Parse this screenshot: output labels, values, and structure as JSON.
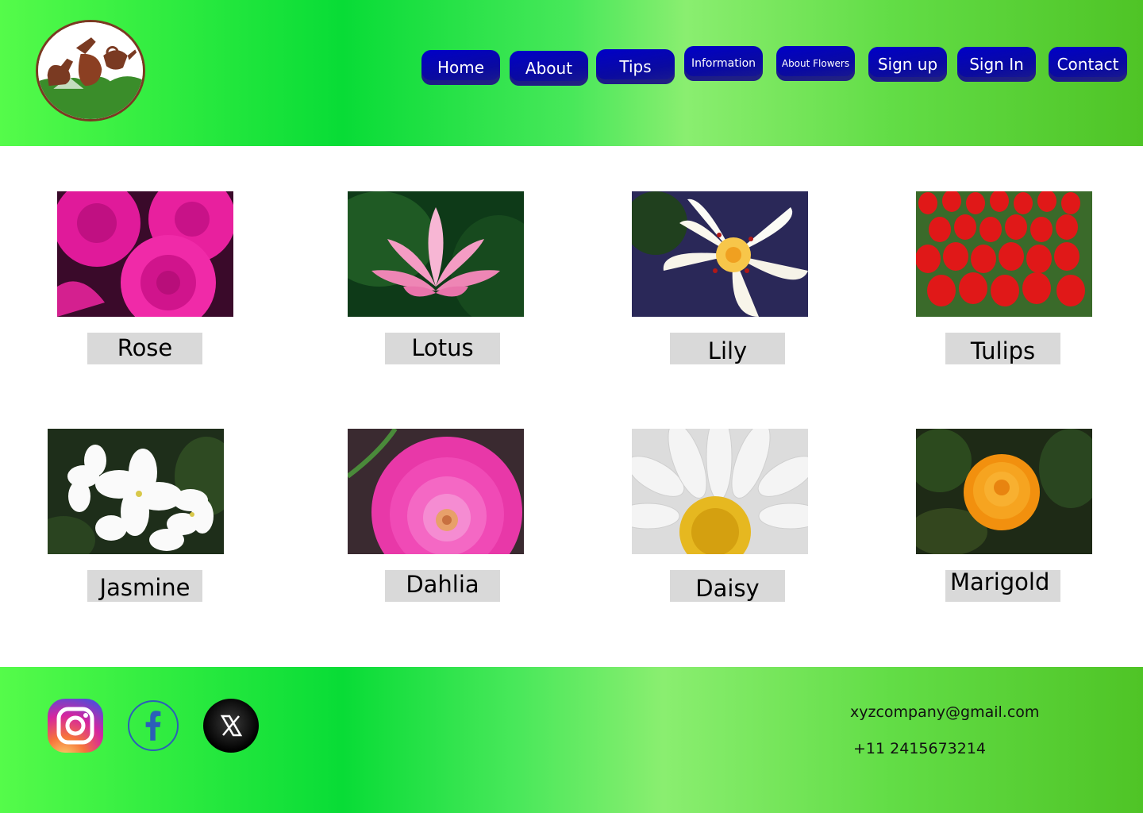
{
  "nav": {
    "items": [
      {
        "label": "Home"
      },
      {
        "label": "About"
      },
      {
        "label": "Tips"
      },
      {
        "label": "Information"
      },
      {
        "label": "About Flowers"
      },
      {
        "label": "Sign up"
      },
      {
        "label": "Sign In"
      },
      {
        "label": "Contact"
      }
    ],
    "button_color": "#0a0aa0"
  },
  "flowers": [
    {
      "name": "Rose"
    },
    {
      "name": "Lotus"
    },
    {
      "name": "Lily"
    },
    {
      "name": "Tulips"
    },
    {
      "name": "Jasmine"
    },
    {
      "name": "Dahlia"
    },
    {
      "name": "Daisy"
    },
    {
      "name": "Marigold"
    }
  ],
  "footer": {
    "social": [
      {
        "icon": "instagram-icon"
      },
      {
        "icon": "facebook-icon"
      },
      {
        "icon": "x-icon"
      }
    ],
    "email": "xyzcompany@gmail.com",
    "phone": "+11 2415673214"
  },
  "colors": {
    "header_green": "#08dc36",
    "nav_blue": "#0a0aa0",
    "label_gray": "#d9d9d9"
  }
}
